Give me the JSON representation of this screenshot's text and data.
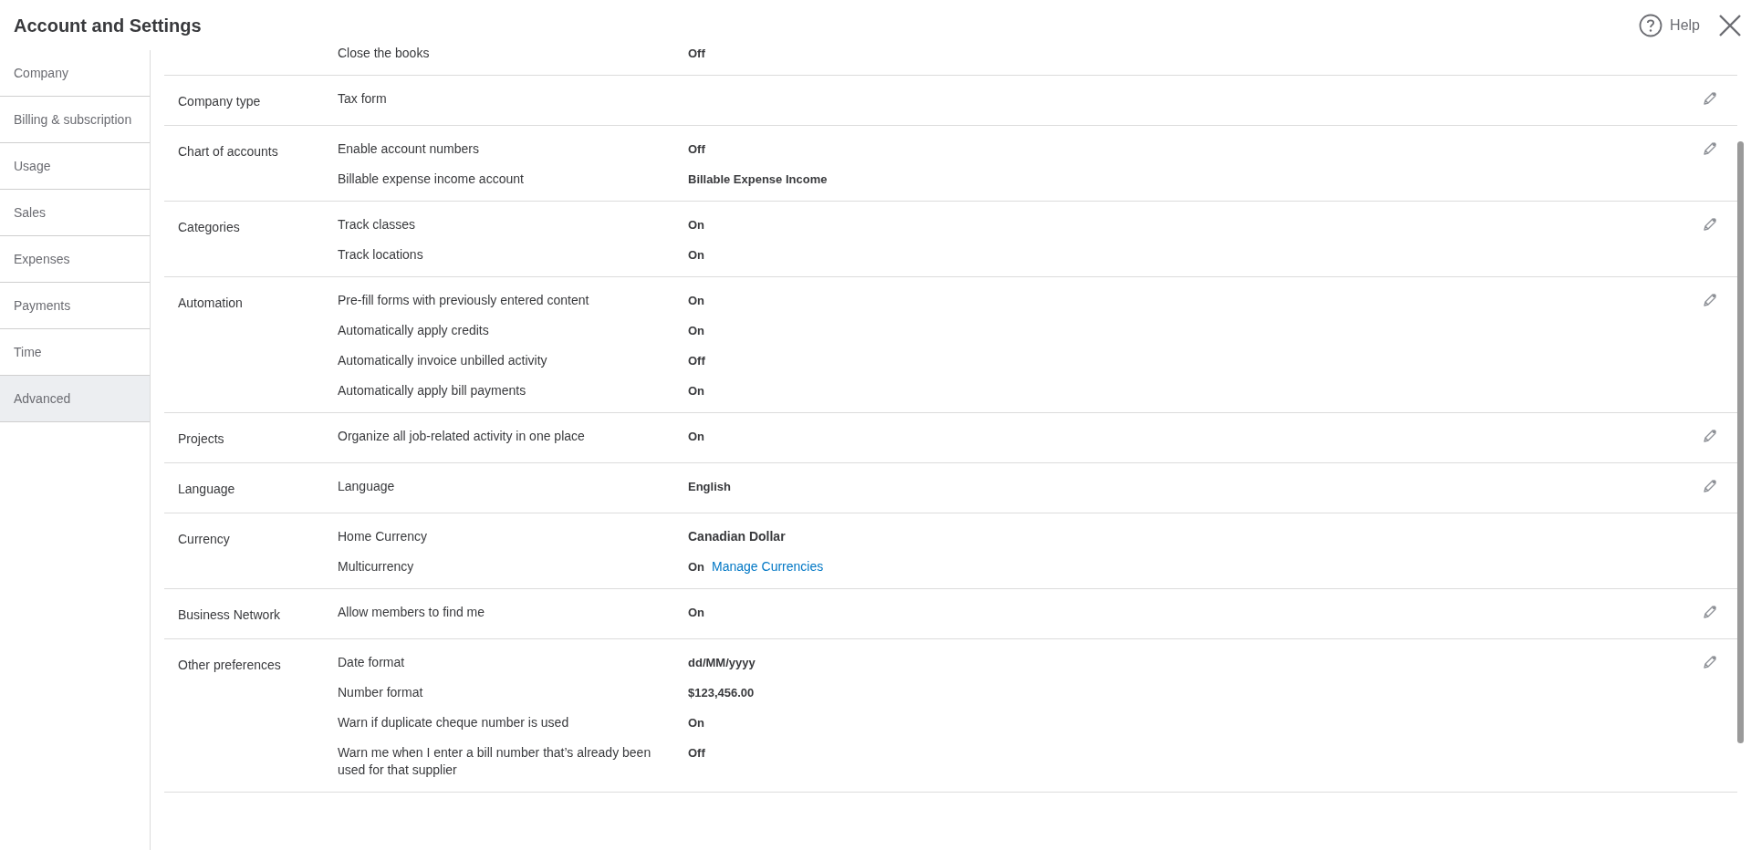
{
  "title": "Account and Settings",
  "help": "Help",
  "sidebar": [
    {
      "label": "Company",
      "selected": false
    },
    {
      "label": "Billing & subscription",
      "selected": false
    },
    {
      "label": "Usage",
      "selected": false
    },
    {
      "label": "Sales",
      "selected": false
    },
    {
      "label": "Expenses",
      "selected": false
    },
    {
      "label": "Payments",
      "selected": false
    },
    {
      "label": "Time",
      "selected": false
    },
    {
      "label": "Advanced",
      "selected": true
    }
  ],
  "sections": [
    {
      "editable": false,
      "settings": [
        {
          "label": "Close the books",
          "value": "Off"
        }
      ]
    },
    {
      "label": "Company type",
      "editable": true,
      "settings": [
        {
          "label": "Tax form"
        }
      ]
    },
    {
      "label": "Chart of accounts",
      "editable": true,
      "settings": [
        {
          "label": "Enable account numbers",
          "value": "Off"
        },
        {
          "label": "Billable expense income account",
          "value": "Billable Expense Income"
        }
      ]
    },
    {
      "label": "Categories",
      "editable": true,
      "settings": [
        {
          "label": "Track classes",
          "value": "On"
        },
        {
          "label": "Track locations",
          "value": "On"
        }
      ]
    },
    {
      "label": "Automation",
      "editable": true,
      "settings": [
        {
          "label": "Pre-fill forms with previously entered content",
          "value": "On"
        },
        {
          "label": "Automatically apply credits",
          "value": "On"
        },
        {
          "label": "Automatically invoice unbilled activity",
          "value": "Off"
        },
        {
          "label": "Automatically apply bill payments",
          "value": "On"
        }
      ]
    },
    {
      "label": "Projects",
      "editable": true,
      "settings": [
        {
          "label": "Organize all job-related activity in one place",
          "value": "On"
        }
      ]
    },
    {
      "label": "Language",
      "editable": true,
      "settings": [
        {
          "label": "Language",
          "value": "English"
        }
      ]
    },
    {
      "label": "Currency",
      "editable": false,
      "settings": [
        {
          "label": "Home Currency",
          "value": "Canadian Dollar"
        },
        {
          "label": "Multicurrency",
          "value": "On",
          "link": "Manage Currencies"
        }
      ]
    },
    {
      "label": "Business Network",
      "editable": true,
      "settings": [
        {
          "label": "Allow members to find me",
          "value": "On"
        }
      ]
    },
    {
      "label": "Other preferences",
      "editable": true,
      "settings": [
        {
          "label": "Date format",
          "value": "dd/MM/yyyy"
        },
        {
          "label": "Number format",
          "value": "$123,456.00"
        },
        {
          "label": "Warn if duplicate cheque number is used",
          "value": "On"
        },
        {
          "label": "Warn me when I enter a bill number that’s already been used for that supplier",
          "value": "Off"
        }
      ]
    }
  ]
}
